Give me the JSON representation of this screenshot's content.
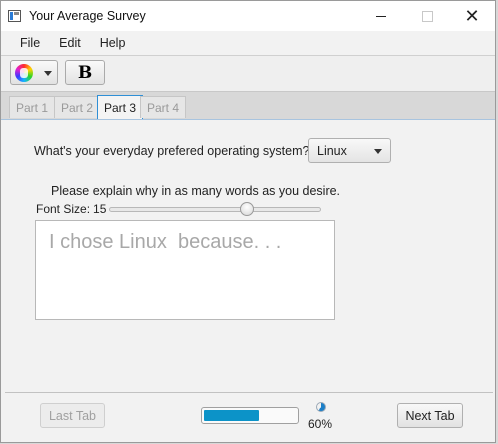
{
  "window": {
    "title": "Your Average Survey"
  },
  "menu": {
    "items": [
      "File",
      "Edit",
      "Help"
    ]
  },
  "toolbar": {
    "bold_label": "B"
  },
  "tabs": [
    {
      "label": "Part 1",
      "selected": false
    },
    {
      "label": "Part 2",
      "selected": false
    },
    {
      "label": "Part 3",
      "selected": true
    },
    {
      "label": "Part 4",
      "selected": false
    }
  ],
  "question": {
    "text": "What's your everyday prefered operating system?",
    "selected_os": "Linux"
  },
  "explain": {
    "prompt": "Please explain why in as many words as you desire.",
    "font_size_label": "Font Size:",
    "font_size_value": "15",
    "answer_text": "I chose Linux  because. . ."
  },
  "footer": {
    "last_tab_label": "Last Tab",
    "next_tab_label": "Next Tab",
    "progress_percent": 60,
    "progress_text": "60%"
  }
}
